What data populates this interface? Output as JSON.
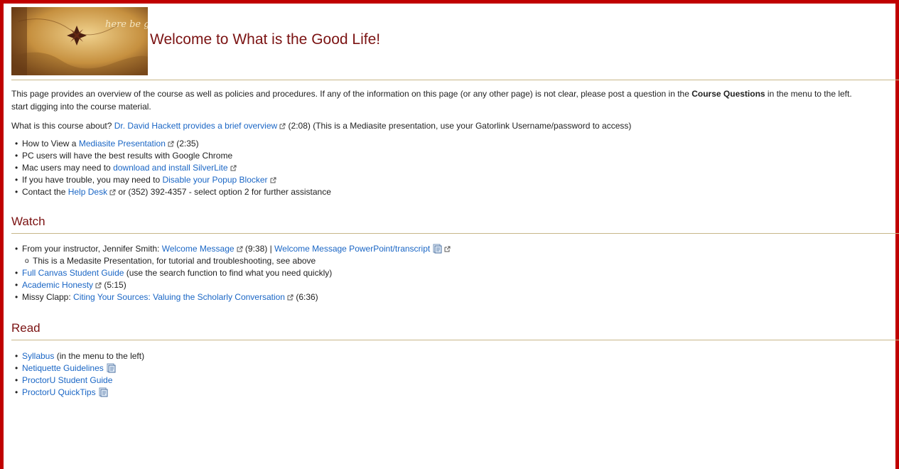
{
  "header": {
    "title": "Welcome to What is the Good Life!",
    "banner_text": "here be games"
  },
  "intro": {
    "part1": "This page provides an overview of the course as well as policies and procedures.  If any of the information on this page (or any other page) is not clear, please post a question in the ",
    "bold": "Course Questions",
    "part2": " in the menu to the left.",
    "line2": "start digging into the course material."
  },
  "about": {
    "prefix": "What is this course about?  ",
    "link": "Dr. David Hackett provides a brief overview",
    "suffix": " (2:08) (This is a Mediasite presentation, use your Gatorlink Username/password to access)"
  },
  "help_list": [
    {
      "prefix": "How to View a ",
      "link": "Mediasite Presentation",
      "suffix": " (2:35)"
    },
    {
      "prefix": "PC users will have the best results with Google Chrome"
    },
    {
      "prefix": "Mac users may need to ",
      "link": "download and install SilverLite",
      "suffix": ""
    },
    {
      "prefix": "If you have trouble, you may need to ",
      "link": "Disable your Popup Blocker",
      "suffix": ""
    },
    {
      "prefix": "Contact the ",
      "link": "Help Desk",
      "suffix": " or (352) 392-4357 - select option 2 for further assistance"
    }
  ],
  "watch": {
    "heading": "Watch",
    "item1_prefix": "From your instructor, Jennifer Smith: ",
    "item1_link1": "Welcome Message",
    "item1_mid": " (9:38) | ",
    "item1_link2": "Welcome Message PowerPoint/transcript",
    "item1_sub": "This is a Medasite Presentation, for tutorial and troubleshooting, see above",
    "item2_link": "Full Canvas Student Guide",
    "item2_suffix": " (use the search function to find what you need quickly)",
    "item3_link": "Academic Honesty",
    "item3_suffix": " (5:15)",
    "item4_prefix": "Missy Clapp:  ",
    "item4_link": "Citing Your Sources:  Valuing the Scholarly Conversation",
    "item4_suffix": " (6:36)"
  },
  "read": {
    "heading": "Read",
    "item1_link": "Syllabus",
    "item1_suffix": " (in the menu to the left)",
    "item2_link": "Netiquette Guidelines",
    "item3_link": "ProctorU Student Guide",
    "item4_link": "ProctorU QuickTips"
  },
  "colors": {
    "frame": "#c00000",
    "heading": "#7b1313",
    "link": "#1a66c5",
    "rule": "#c8b789"
  }
}
